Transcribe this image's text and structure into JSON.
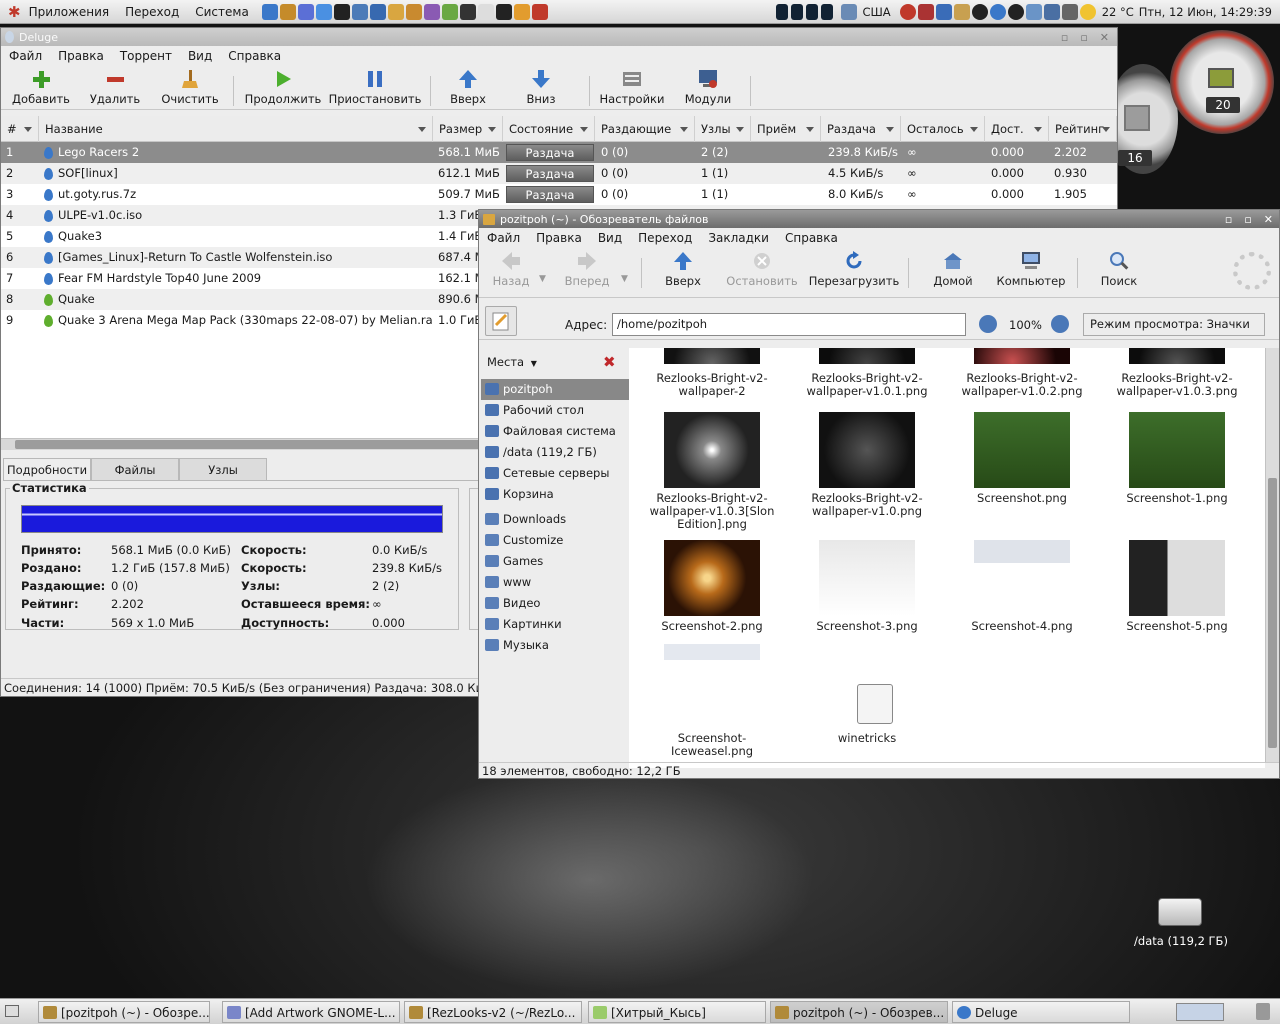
{
  "top_panel": {
    "menus": [
      "Приложения",
      "Переход",
      "Система"
    ],
    "keyboard_layout": "США",
    "weather": "22 °C",
    "clock": "Птн, 12 Июн, 14:29:39"
  },
  "deluge": {
    "title": "Deluge",
    "menu": [
      "Файл",
      "Правка",
      "Торрент",
      "Вид",
      "Справка"
    ],
    "toolbar": [
      "Добавить",
      "Удалить",
      "Очистить",
      "Продолжить",
      "Приостановить",
      "Вверх",
      "Вниз",
      "Настройки",
      "Модули"
    ],
    "columns": [
      "#",
      "Название",
      "Размер",
      "Состояние",
      "Раздающие",
      "Узлы",
      "Приём",
      "Раздача",
      "Осталось",
      "Дост.",
      "Рейтинг"
    ],
    "rows": [
      {
        "n": "1",
        "name": "Lego Racers 2",
        "size": "568.1 МиБ",
        "state": "Раздача",
        "seeds": "0 (0)",
        "peers": "2 (2)",
        "down": "",
        "up": "239.8 КиБ/s",
        "eta": "∞",
        "avail": "0.000",
        "ratio": "2.202"
      },
      {
        "n": "2",
        "name": "SOF[linux]",
        "size": "612.1 МиБ",
        "state": "Раздача",
        "seeds": "0 (0)",
        "peers": "1 (1)",
        "down": "",
        "up": "4.5 КиБ/s",
        "eta": "∞",
        "avail": "0.000",
        "ratio": "0.930"
      },
      {
        "n": "3",
        "name": "ut.goty.rus.7z",
        "size": "509.7 МиБ",
        "state": "Раздача",
        "seeds": "0 (0)",
        "peers": "1 (1)",
        "down": "",
        "up": "8.0 КиБ/s",
        "eta": "∞",
        "avail": "0.000",
        "ratio": "1.905"
      },
      {
        "n": "4",
        "name": "ULPE-v1.0c.iso",
        "size": "1.3 ГиБ"
      },
      {
        "n": "5",
        "name": "Quake3",
        "size": "1.4 ГиБ"
      },
      {
        "n": "6",
        "name": "[Games_Linux]-Return To Castle Wolfenstein.iso",
        "size": "687.4 М"
      },
      {
        "n": "7",
        "name": "Fear FM Hardstyle Top40 June 2009",
        "size": "162.1 М"
      },
      {
        "n": "8",
        "name": "Quake",
        "size": "890.6 М"
      },
      {
        "n": "9",
        "name": "Quake 3 Arena Mega Map Pack (330maps 22-08-07) by Melian.rar",
        "size": "1.0 ГиБ"
      }
    ],
    "details_tabs": [
      "Подробности",
      "Файлы",
      "Узлы"
    ],
    "stats_title": "Статистика",
    "stats": {
      "received_label": "Принято:",
      "received": "568.1 МиБ (0.0 КиБ)",
      "sent_label": "Роздано:",
      "sent": "1.2 ГиБ (157.8 МиБ)",
      "seeds_label": "Раздающие:",
      "seeds": "0 (0)",
      "ratio_label": "Рейтинг:",
      "ratio": "2.202",
      "pieces_label": "Части:",
      "pieces": "569 x 1.0 МиБ",
      "dl_speed_label": "Скорость:",
      "dl_speed": "0.0 КиБ/s",
      "ul_speed_label": "Скорость:",
      "ul_speed": "239.8 КиБ/s",
      "peers_label": "Узлы:",
      "peers": "2 (2)",
      "eta_label": "Оставшееся время:",
      "eta": "∞",
      "avail_label": "Доступность:",
      "avail": "0.000",
      "progress": 1.0
    },
    "status": "Соединения: 14 (1000)   Приём: 70.5 КиБ/s (Без ограничения)   Раздача: 308.0 Ки"
  },
  "gauges": {
    "cpu": "16",
    "mem": "20"
  },
  "nautilus": {
    "title": "pozitpoh (~) - Обозреватель файлов",
    "menu": [
      "Файл",
      "Правка",
      "Вид",
      "Переход",
      "Закладки",
      "Справка"
    ],
    "toolbar": [
      "Назад",
      "Вперед",
      "Вверх",
      "Остановить",
      "Перезагрузить",
      "Домой",
      "Компьютер",
      "Поиск"
    ],
    "address_label": "Адрес:",
    "address": "/home/pozitpoh",
    "zoom": "100%",
    "view_mode": "Режим просмотра: Значки",
    "places_label": "Места",
    "places": [
      "pozitpoh",
      "Рабочий стол",
      "Файловая система",
      "/data (119,2 ГБ)",
      "Сетевые серверы",
      "Корзина"
    ],
    "bookmarks": [
      "Downloads",
      "Customize",
      "Games",
      "www",
      "Видео",
      "Картинки",
      "Музыка"
    ],
    "files": [
      "Rezlooks-Bright-v2-wallpaper-2",
      "Rezlooks-Bright-v2-wallpaper-v1.0.1.png",
      "Rezlooks-Bright-v2-wallpaper-v1.0.2.png",
      "Rezlooks-Bright-v2-wallpaper-v1.0.3.png",
      "Rezlooks-Bright-v2-wallpaper-v1.0.3[Slon Edition].png",
      "Rezlooks-Bright-v2-wallpaper-v1.0.png",
      "Screenshot.png",
      "Screenshot-1.png",
      "Screenshot-2.png",
      "Screenshot-3.png",
      "Screenshot-4.png",
      "Screenshot-5.png",
      "Screenshot-Iceweasel.png",
      "winetricks"
    ],
    "status": "18 элементов, свободно: 12,2 ГБ"
  },
  "desktop": {
    "drive_label": "/data (119,2 ГБ)"
  },
  "taskbar": [
    "[pozitpoh (~) - Обозре...",
    "[Add Artwork GNOME-L...",
    "[RezLooks-v2 (~/RezLo...",
    "[Хитрый_Кысь]",
    "pozitpoh (~) - Обозрев...",
    "Deluge"
  ]
}
